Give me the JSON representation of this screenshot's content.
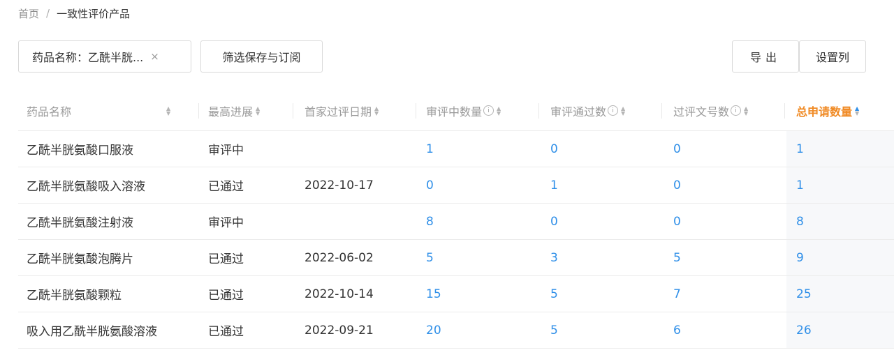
{
  "breadcrumb": {
    "home": "首页",
    "separator": "/",
    "current": "一致性评价产品"
  },
  "toolbar": {
    "filter_chip": "药品名称：乙酰半胱...",
    "filter_close": "×",
    "save_subscribe": "筛选保存与订阅",
    "export": "导出",
    "set_columns": "设置列"
  },
  "table": {
    "columns": [
      {
        "label": "药品名称",
        "info": false,
        "active": false
      },
      {
        "label": "最高进展",
        "info": false,
        "active": false
      },
      {
        "label": "首家过评日期",
        "info": false,
        "active": false
      },
      {
        "label": "审评中数量",
        "info": true,
        "active": false
      },
      {
        "label": "审评通过数",
        "info": true,
        "active": false
      },
      {
        "label": "过评文号数",
        "info": true,
        "active": false
      },
      {
        "label": "总申请数量",
        "info": false,
        "active": true
      }
    ],
    "rows": [
      [
        "乙酰半胱氨酸口服液",
        "审评中",
        "",
        "1",
        "0",
        "0",
        "1"
      ],
      [
        "乙酰半胱氨酸吸入溶液",
        "已通过",
        "2022-10-17",
        "0",
        "1",
        "0",
        "1"
      ],
      [
        "乙酰半胱氨酸注射液",
        "审评中",
        "",
        "8",
        "0",
        "0",
        "8"
      ],
      [
        "乙酰半胱氨酸泡腾片",
        "已通过",
        "2022-06-02",
        "5",
        "3",
        "5",
        "9"
      ],
      [
        "乙酰半胱氨酸颗粒",
        "已通过",
        "2022-10-14",
        "15",
        "5",
        "7",
        "25"
      ],
      [
        "吸入用乙酰半胱氨酸溶液",
        "已通过",
        "2022-09-21",
        "20",
        "5",
        "6",
        "26"
      ]
    ]
  },
  "icons": {
    "sort_up": "sort-up-icon",
    "sort_down": "sort-down-icon",
    "info": "info-circle-icon",
    "close": "close-icon"
  },
  "colors": {
    "link_number": "#2f8fe8",
    "active_header": "#f08a24",
    "header_text": "#9a9a9a",
    "border": "#d9d9d9"
  }
}
